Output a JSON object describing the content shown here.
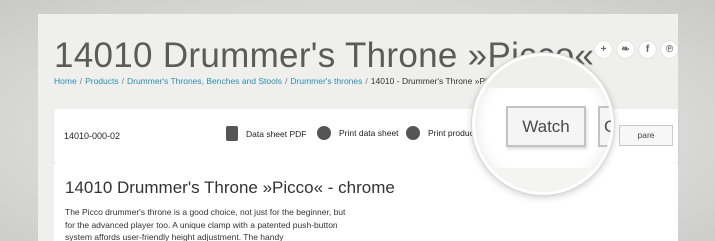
{
  "product": {
    "title": "14010 Drummer's Throne »Picco«",
    "sku": "14010-000-02",
    "content_title": "14010 Drummer's Throne »Picco« - chrome",
    "description": "The Picco drummer's throne is a good choice, not just for the beginner, but for the advanced player too. A unique clamp with a patented push-button system affords user-friendly height adjustment. The handy"
  },
  "breadcrumb": {
    "items": [
      "Home",
      "Products",
      "Drummer's Thrones, Benches and Stools",
      "Drummer's thrones"
    ],
    "current": "14010 - Drummer's Throne »Picco« ch",
    "separator": "/"
  },
  "social": {
    "icons": [
      "plus-icon",
      "twitter-icon",
      "facebook-icon",
      "pinterest-icon"
    ],
    "glyphs": [
      "+",
      "❧",
      "f",
      "℗"
    ]
  },
  "toolbar": {
    "datasheet_label": "Data sheet PDF",
    "print_label": "Print data sheet",
    "print_product_label": "Print product",
    "compare_label": "pare"
  },
  "magnifier": {
    "watch_label": "Watch",
    "compare_label": "Co"
  },
  "colors": {
    "link": "#2d8fb0",
    "title": "#5b5b5b",
    "background": "#efefed"
  }
}
